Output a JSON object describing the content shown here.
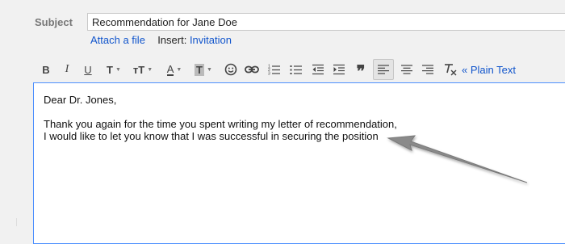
{
  "compose": {
    "subject_label": "Subject",
    "subject_value": "Recommendation for Jane Doe",
    "attach_label": "Attach a file",
    "insert_label": "Insert:",
    "invitation_label": "Invitation"
  },
  "toolbar": {
    "bold": "B",
    "italic": "I",
    "underline": "U",
    "font": "T",
    "size": "тT",
    "color": "A",
    "highlight": "T",
    "plain_text": "« Plain Text",
    "icons": [
      "bold-icon",
      "italic-icon",
      "underline-icon",
      "font-family-icon",
      "font-size-icon",
      "text-color-icon",
      "highlight-icon",
      "emoji-icon",
      "link-icon",
      "numbered-list-icon",
      "bulleted-list-icon",
      "indent-less-icon",
      "indent-more-icon",
      "quote-icon",
      "align-left-icon",
      "align-center-icon",
      "align-right-icon",
      "remove-formatting-icon"
    ]
  },
  "body": {
    "line1": "Dear Dr. Jones,",
    "line2": "Thank you again for the time you spent writing my letter of recommendation,",
    "line3": "I would like to let you know that I was successful in securing the position"
  },
  "colors": {
    "link": "#1155cc",
    "editor_border": "#4d90fe",
    "arrow": "#8a8a8a"
  }
}
